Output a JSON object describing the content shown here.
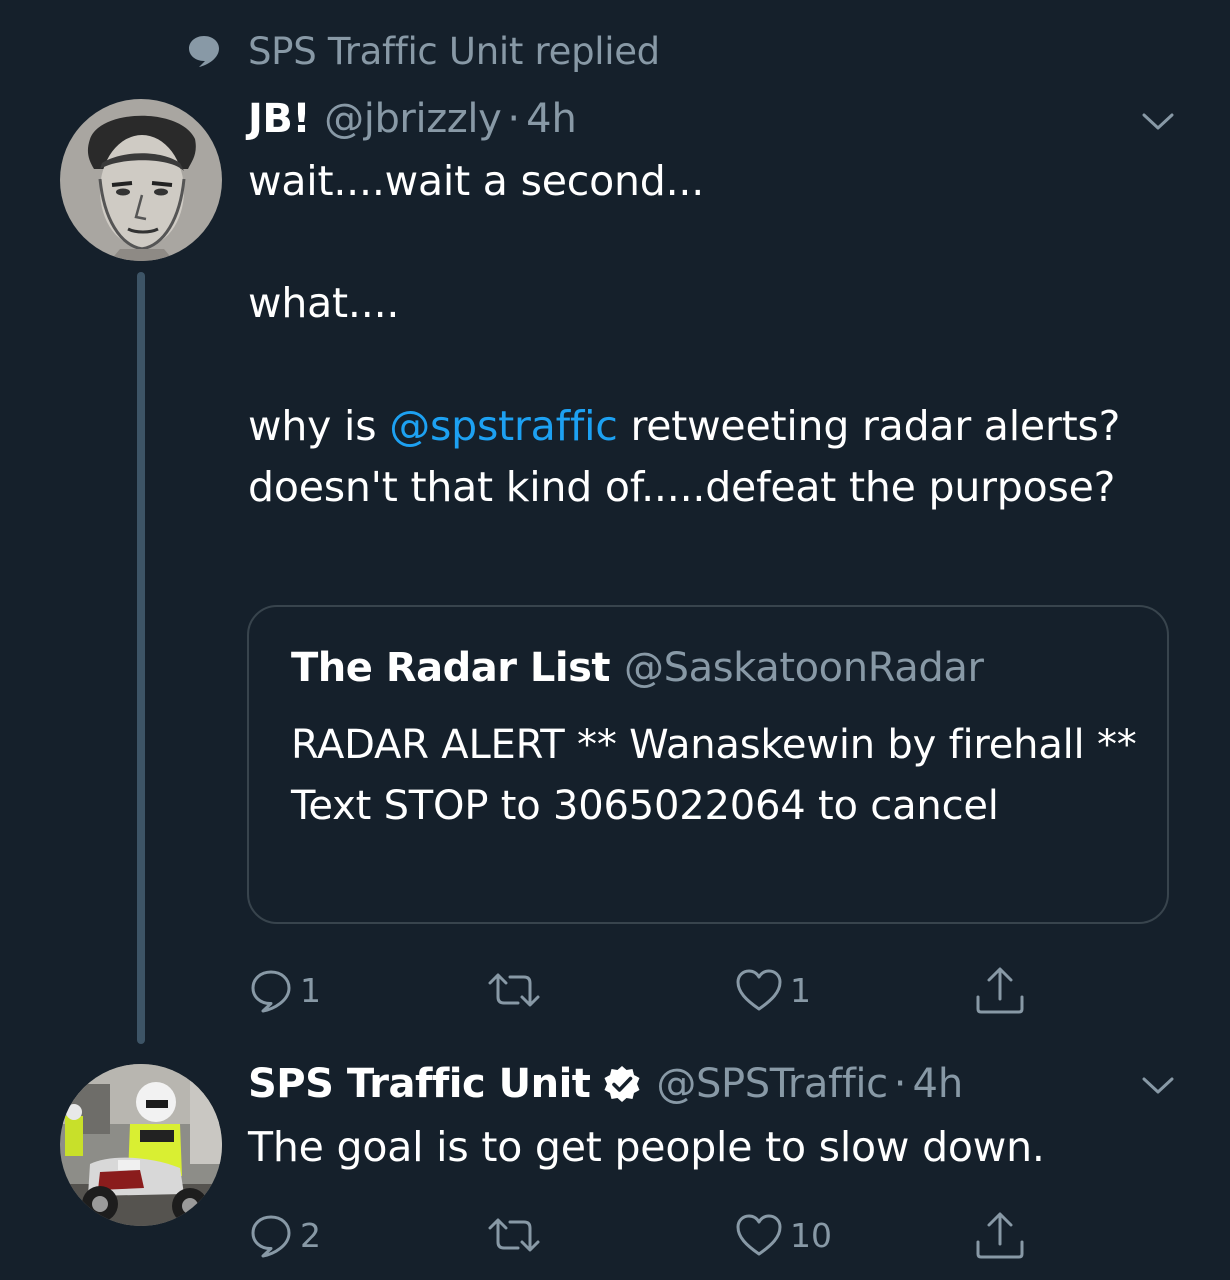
{
  "context": {
    "icon": "reply-bubble-icon",
    "label": "SPS Traffic Unit replied"
  },
  "colors": {
    "background": "#15202b",
    "secondary_text": "#8899a6",
    "link": "#1da1f2",
    "border": "#38444d"
  },
  "tweets": [
    {
      "display_name": "JB!",
      "handle": "@jbrizzly",
      "separator": "·",
      "time": "4h",
      "text_line1": "wait....wait a second...",
      "text_line2": "what....",
      "text_pre_mention": "why is ",
      "mention": "@spstraffic",
      "text_post_mention": " retweeting radar alerts? doesn't that kind of.....defeat the purpose?",
      "quote": {
        "display_name": "The Radar List",
        "handle": "@SaskatoonRadar",
        "text": "RADAR ALERT ** Wanaskewin by firehall ** Text STOP to 3065022064 to cancel"
      },
      "actions": {
        "reply_count": "1",
        "retweet_count": "",
        "like_count": "1"
      }
    },
    {
      "display_name": "SPS Traffic Unit",
      "verified": true,
      "handle": "@SPSTraffic",
      "separator": "·",
      "time": "4h",
      "text": "The goal is to get people to slow down.",
      "actions": {
        "reply_count": "2",
        "retweet_count": "",
        "like_count": "10"
      }
    }
  ]
}
